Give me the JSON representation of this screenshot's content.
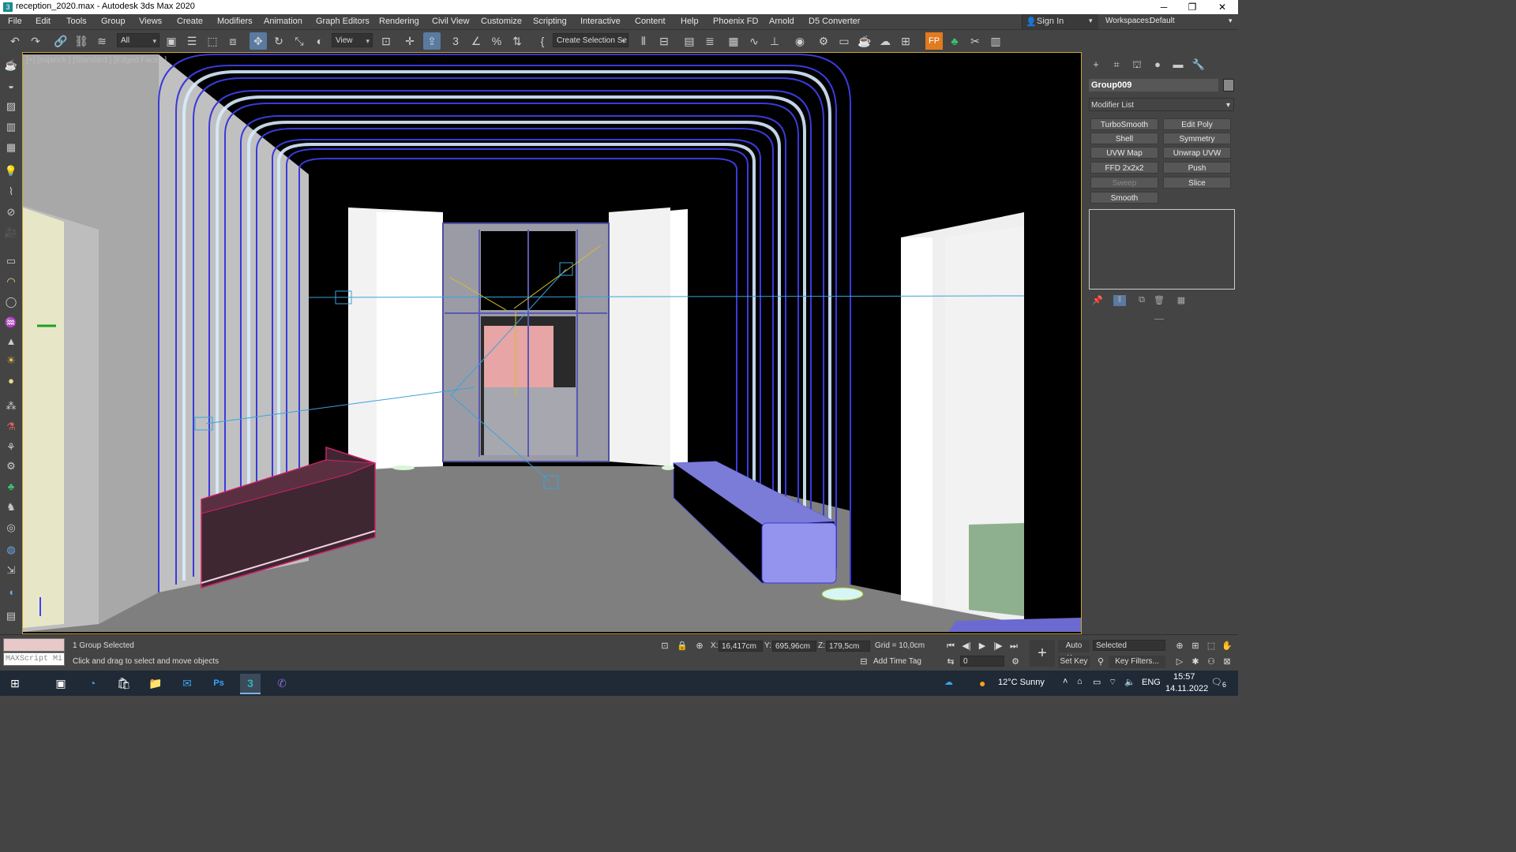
{
  "window": {
    "title": "reception_2020.max - Autodesk 3ds Max 2020",
    "minimize": "─",
    "maximize": "❐",
    "close": "✕"
  },
  "menu": [
    "File",
    "Edit",
    "Tools",
    "Group",
    "Views",
    "Create",
    "Modifiers",
    "Animation",
    "Graph Editors",
    "Rendering",
    "Civil View",
    "Customize",
    "Scripting",
    "Interactive",
    "Content",
    "Help",
    "Phoenix FD",
    "Arnold",
    "D5 Converter"
  ],
  "signin": {
    "label": "Sign In"
  },
  "workspaces": {
    "label": "Workspaces:",
    "value": "Default"
  },
  "toolbar": {
    "selection_filter": "All",
    "ref_coord": "View",
    "selection_set_placeholder": "Create Selection Se"
  },
  "viewport": {
    "label": "[+] [mijanck ] [Standard ] [Edged Faces ]"
  },
  "command_panel": {
    "object_name": "Group009",
    "modifier_list": "Modifier List",
    "modifier_buttons": [
      "TurboSmooth",
      "Edit Poly",
      "Shell",
      "Symmetry",
      "UVW Map",
      "Unwrap UVW",
      "FFD 2x2x2",
      "Push",
      "Sweep",
      "Slice",
      "Smooth"
    ]
  },
  "status": {
    "selection": "1 Group Selected",
    "prompt": "Click and drag to select and move objects",
    "maxscript": "MAXScript Mi",
    "x_label": "X:",
    "x": "16,417cm",
    "y_label": "Y:",
    "y": "695,96cm",
    "z_label": "Z:",
    "z": "179,5cm",
    "grid": "Grid = 10,0cm",
    "add_time_tag": "Add Time Tag",
    "auto_key": "Auto Key",
    "set_key": "Set Key",
    "selected": "Selected",
    "key_filters": "Key Filters...",
    "frame": "0"
  },
  "taskbar": {
    "weather": "12°C  Sunny",
    "lang": "ENG",
    "time": "15:57",
    "date": "14.11.2022",
    "notifications": "6"
  }
}
